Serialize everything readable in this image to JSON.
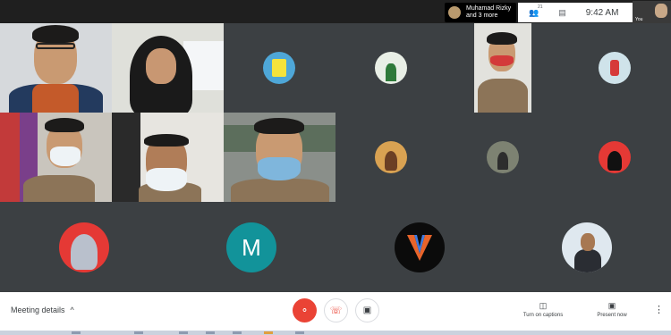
{
  "topbar": {
    "presenter_line1": "Muhamad Rizky",
    "presenter_line2": "and 3 more",
    "participant_count": "21",
    "people_icon": "people-icon",
    "chat_icon": "chat-icon",
    "time": "9:42 AM",
    "self_label": "You"
  },
  "tiles": {
    "letter_avatar": "M"
  },
  "bottombar": {
    "meeting_details": "Meeting details",
    "captions_label": "Turn on captions",
    "present_label": "Present now"
  },
  "colors": {
    "background": "#202124",
    "accent_red": "#ea4335",
    "avatar_teal": "#12939a",
    "avatar_red": "#e53935",
    "scout_khaki": "#8c7458"
  }
}
